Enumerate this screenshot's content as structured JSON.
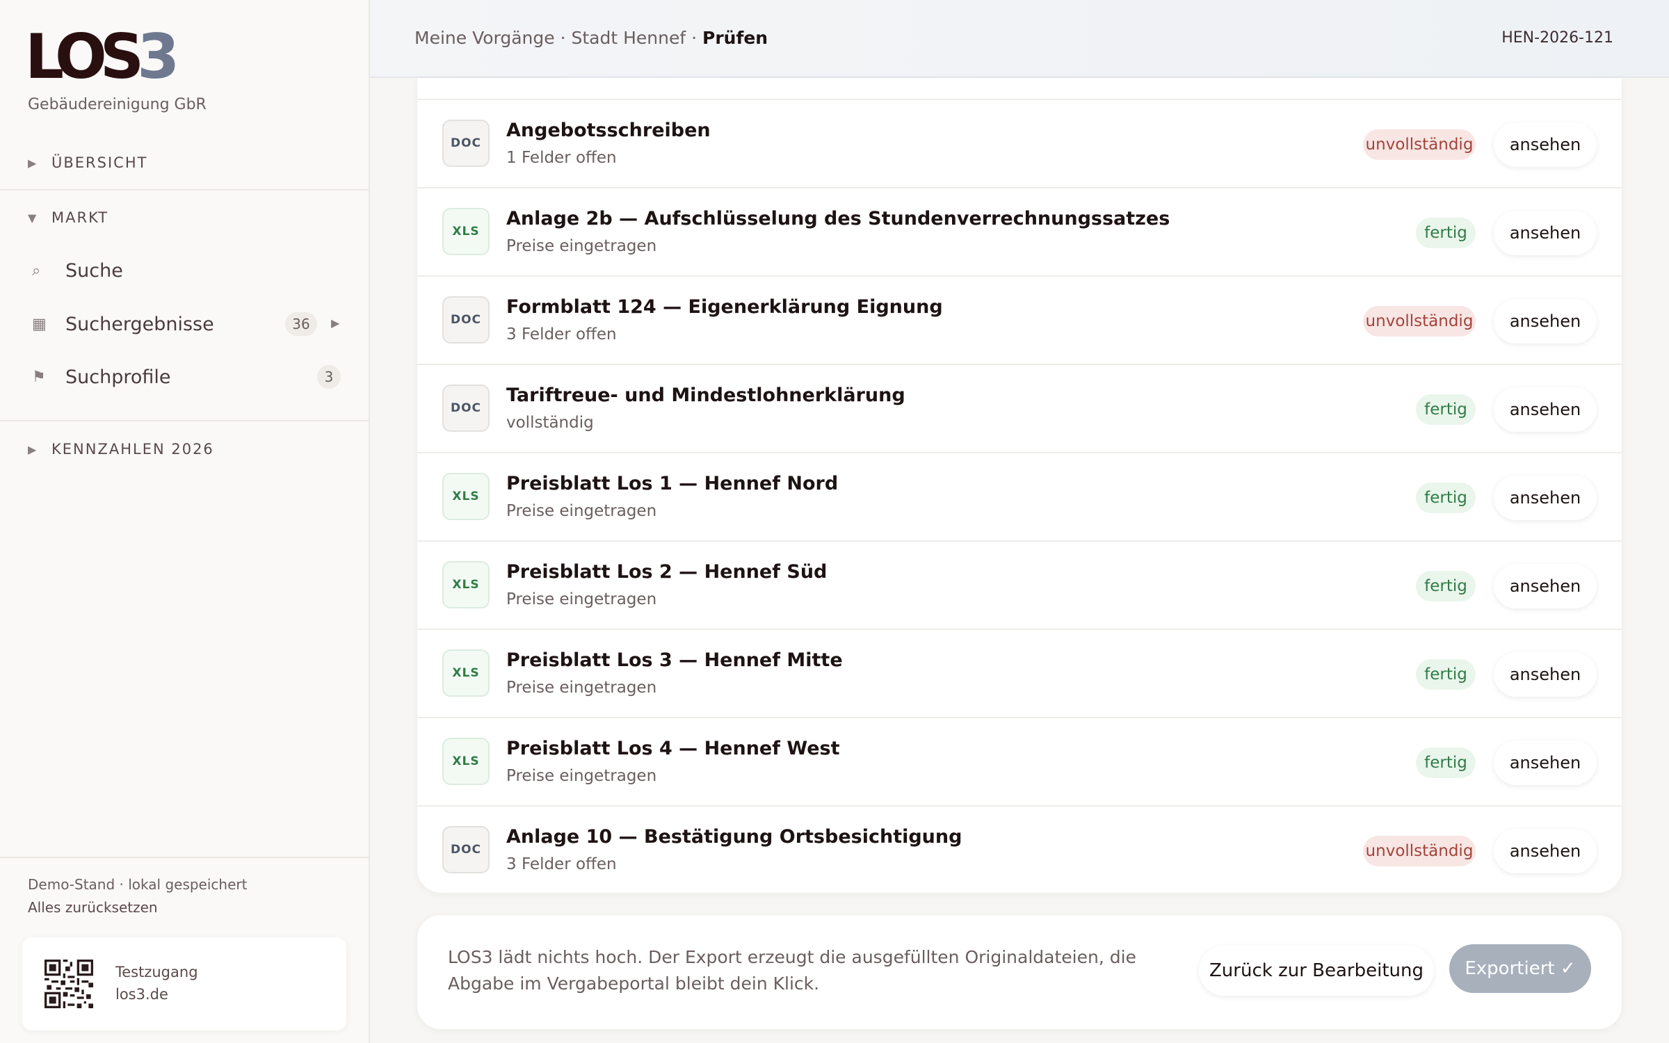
{
  "brand": {
    "logo_main": "LOS",
    "logo_accent": "3",
    "company": "Gebäudereinigung GbR"
  },
  "sidebar": {
    "sections": [
      {
        "label": "ÜBERSICHT",
        "expanded": false
      },
      {
        "label": "MARKT",
        "expanded": true
      },
      {
        "label": "KENNZAHLEN 2026",
        "expanded": false
      }
    ],
    "items": [
      {
        "label": "Suche",
        "icon": "search-icon"
      },
      {
        "label": "Suchergebnisse",
        "icon": "grid-icon",
        "badge": "36"
      },
      {
        "label": "Suchprofile",
        "icon": "flag-icon",
        "badge": "3"
      }
    ],
    "footer": {
      "status": "Demo-Stand · lokal gespeichert",
      "reset_link": "Alles zurücksetzen"
    },
    "qr_card": {
      "line1": "Testzugang",
      "line2": "los3.de"
    }
  },
  "header": {
    "breadcrumb": {
      "part1": "Meine Vorgänge",
      "sep": " · ",
      "part2": "Stadt Hennef",
      "current": "Prüfen"
    },
    "case_id": "HEN-2026-121"
  },
  "documents": [
    {
      "type": "DOC",
      "title": "Angebotsschreiben",
      "subtitle": "1 Felder offen",
      "status": "unvollständig"
    },
    {
      "type": "XLS",
      "title": "Anlage 2b — Aufschlüsselung des Stundenverrechnungssatzes",
      "subtitle": "Preise eingetragen",
      "status": "fertig"
    },
    {
      "type": "DOC",
      "title": "Formblatt 124 — Eigenerklärung Eignung",
      "subtitle": "3 Felder offen",
      "status": "unvollständig"
    },
    {
      "type": "DOC",
      "title": "Tariftreue- und Mindestlohnerklärung",
      "subtitle": "vollständig",
      "status": "fertig"
    },
    {
      "type": "XLS",
      "title": "Preisblatt Los 1 — Hennef Nord",
      "subtitle": "Preise eingetragen",
      "status": "fertig"
    },
    {
      "type": "XLS",
      "title": "Preisblatt Los 2 — Hennef Süd",
      "subtitle": "Preise eingetragen",
      "status": "fertig"
    },
    {
      "type": "XLS",
      "title": "Preisblatt Los 3 — Hennef Mitte",
      "subtitle": "Preise eingetragen",
      "status": "fertig"
    },
    {
      "type": "XLS",
      "title": "Preisblatt Los 4 — Hennef West",
      "subtitle": "Preise eingetragen",
      "status": "fertig"
    },
    {
      "type": "DOC",
      "title": "Anlage 10 — Bestätigung Ortsbesichtigung",
      "subtitle": "3 Felder offen",
      "status": "unvollständig"
    }
  ],
  "view_label": "ansehen",
  "export": {
    "note": "LOS3 lädt nichts hoch. Der Export erzeugt die ausgefüllten Originaldateien, die Abgabe im Vergabeportal bleibt dein Klick.",
    "back_label": "Zurück zur Bearbeitung",
    "export_label": "Exportiert ✓"
  },
  "colors": {
    "brand_dark": "#2a0f10",
    "brand_accent": "#6e7990",
    "incomplete": "#a3433a",
    "done": "#2f7d46"
  }
}
